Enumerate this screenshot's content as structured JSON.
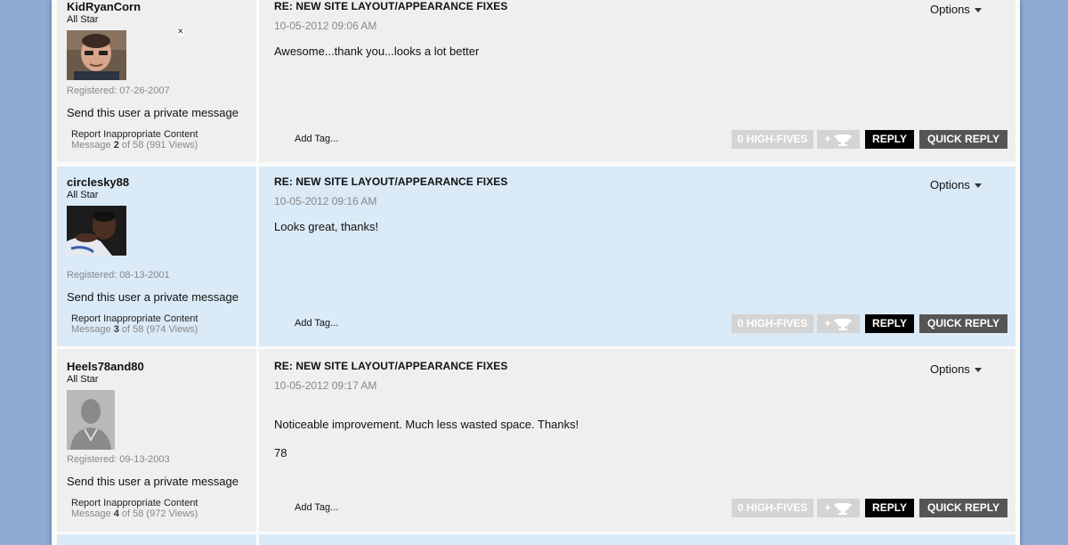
{
  "posts": [
    {
      "username": "KidRyanCorn",
      "rank": "All Star",
      "registered": "Registered: 07-26-2007",
      "pm_link": "Send this user a private message",
      "report_link": "Report Inappropriate Content",
      "message_label": "Message",
      "message_number": "2",
      "message_of": "of 58",
      "views": "(991 Views)",
      "title": "RE: NEW SITE LAYOUT/APPEARANCE FIXES",
      "date": "10-05-2012 09:06 AM",
      "body": [
        "Awesome...thank you...looks a lot better"
      ],
      "avatar_type": "photo-man",
      "theme": "gray"
    },
    {
      "username": "circlesky88",
      "rank": "All Star",
      "registered": "Registered: 08-13-2001",
      "pm_link": "Send this user a private message",
      "report_link": "Report Inappropriate Content",
      "message_label": "Message",
      "message_number": "3",
      "message_of": "of 58",
      "views": "(974 Views)",
      "title": "RE: NEW SITE LAYOUT/APPEARANCE FIXES",
      "date": "10-05-2012 09:16 AM",
      "body": [
        "Looks great, thanks!"
      ],
      "avatar_type": "photo-player",
      "theme": "blue"
    },
    {
      "username": "Heels78and80",
      "rank": "All Star",
      "registered": "Registered: 09-13-2003",
      "pm_link": "Send this user a private message",
      "report_link": "Report Inappropriate Content",
      "message_label": "Message",
      "message_number": "4",
      "message_of": "of 58",
      "views": "(972 Views)",
      "title": "RE: NEW SITE LAYOUT/APPEARANCE FIXES",
      "date": "10-05-2012 09:17 AM",
      "body": [
        "Noticeable improvement. Much less wasted space. Thanks!",
        "78"
      ],
      "avatar_type": "default-silhouette",
      "theme": "gray"
    }
  ],
  "labels": {
    "options": "Options",
    "add_tag": "Add Tag...",
    "high_fives": "0 HIGH-FIVES",
    "plus": "+",
    "reply": "REPLY",
    "quick_reply": "QUICK REPLY"
  },
  "colors": {
    "page_background": "#8eabd6",
    "post_gray": "#efefef",
    "post_blue": "#daeaf6",
    "reply_button": "#000000",
    "quick_reply_button": "#555555",
    "disabled_button": "#d4d4d4"
  },
  "icons": {
    "options_caret": "chevron-down-icon",
    "high_five": "trophy-icon",
    "avatar_close": "close-icon"
  }
}
